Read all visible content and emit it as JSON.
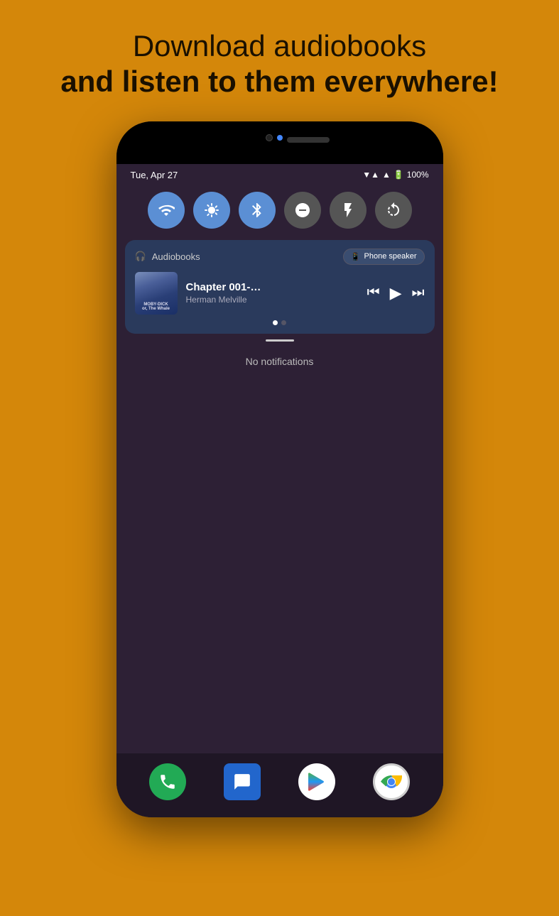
{
  "header": {
    "line1": "Download audiobooks",
    "line2": "and listen to them everywhere!"
  },
  "phone": {
    "status_bar": {
      "time": "Tue, Apr 27",
      "battery": "100%",
      "wifi": "▼▲",
      "signal": "▲",
      "battery_icon": "🔋"
    },
    "toggles": [
      {
        "icon": "wifi",
        "active": true,
        "label": "wifi-toggle"
      },
      {
        "icon": "brightness",
        "active": true,
        "label": "brightness-toggle"
      },
      {
        "icon": "bluetooth",
        "active": true,
        "label": "bluetooth-toggle"
      },
      {
        "icon": "dnd",
        "active": false,
        "label": "dnd-toggle"
      },
      {
        "icon": "flashlight",
        "active": false,
        "label": "flashlight-toggle"
      },
      {
        "icon": "rotate",
        "active": false,
        "label": "rotate-toggle"
      }
    ],
    "notification": {
      "app_name": "Audiobooks",
      "output_button": "Phone speaker",
      "chapter": "Chapter 001-…",
      "author": "Herman Melville",
      "book_title": "MOBY-DICK",
      "dots": [
        true,
        false
      ]
    },
    "no_notifications_text": "No notifications",
    "bottom_apps": [
      "Phone",
      "Messages",
      "Play Store",
      "Chrome"
    ]
  }
}
